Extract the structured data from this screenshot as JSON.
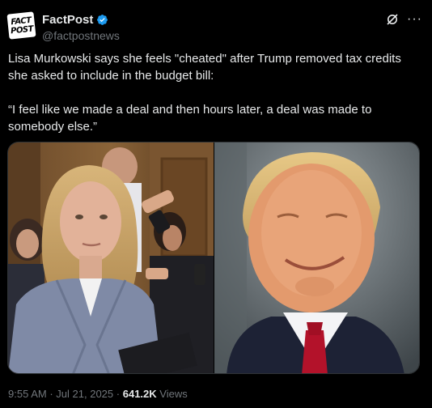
{
  "account": {
    "logo_top": "FACT",
    "logo_bottom": "POST",
    "display_name": "FactPost",
    "handle": "@factpostnews"
  },
  "tweet": {
    "paragraph1": "Lisa Murkowski says she feels \"cheated\" after Trump removed tax credits she asked to include in the budget bill:",
    "paragraph2": "“I feel like we made a deal and then hours later, a deal was made to somebody else.”"
  },
  "meta": {
    "time": "9:55 AM",
    "date": "Jul 21, 2025",
    "separator": "·",
    "views_count": "641.2K",
    "views_label": "Views"
  },
  "colors": {
    "background": "#000000",
    "text": "#e7e9ea",
    "muted": "#71767b",
    "verified": "#1d9bf0"
  },
  "icons": {
    "verified": "verified-badge-icon",
    "grok": "grok-icon",
    "more": "more-dots-icon"
  }
}
